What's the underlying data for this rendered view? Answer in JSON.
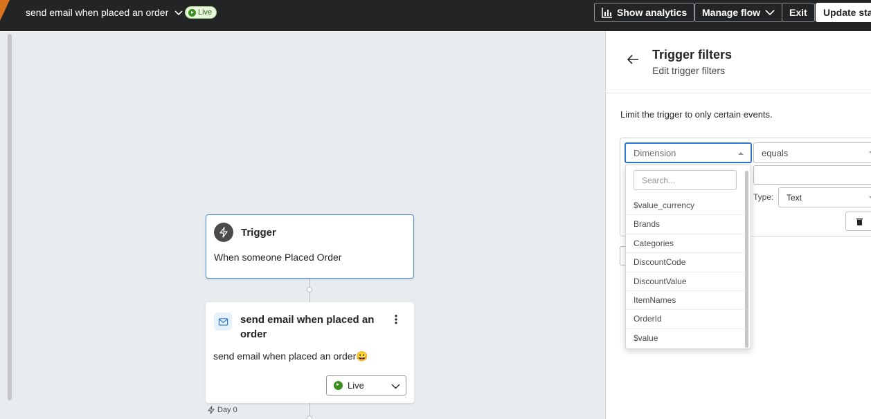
{
  "topbar": {
    "flow_name": "send email when placed an order",
    "status_badge": "Live",
    "show_analytics": "Show analytics",
    "manage_flow": "Manage flow",
    "exit": "Exit",
    "update_status": "Update stat",
    "accent_color": "#d9731e"
  },
  "canvas": {
    "trigger": {
      "title": "Trigger",
      "description": "When someone Placed Order"
    },
    "email_step": {
      "title": "send email when placed an order",
      "description": "send email when placed an order😀",
      "status": "Live"
    },
    "delay_label": "Day 0"
  },
  "panel": {
    "title": "Trigger filters",
    "subtitle": "Edit trigger filters",
    "intro": "Limit the trigger to only certain events.",
    "filter": {
      "dimension_placeholder": "Dimension",
      "operator": "equals",
      "type_label": "Type:",
      "type_value": "Text"
    },
    "dropdown": {
      "search_placeholder": "Search...",
      "options": [
        "$value_currency",
        "Brands",
        "Categories",
        "DiscountCode",
        "DiscountValue",
        "ItemNames",
        "OrderId",
        "$value"
      ]
    }
  }
}
